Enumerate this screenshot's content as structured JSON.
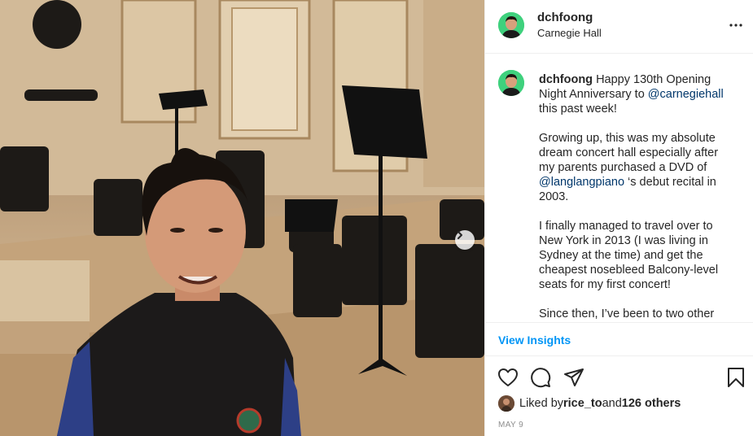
{
  "post": {
    "username": "dchfoong",
    "location": "Carnegie Hall",
    "caption": {
      "username": "dchfoong",
      "p1_a": "Happy 130th Opening Night Anniversary to ",
      "p1_mention": "@carnegiehall",
      "p1_b": " this past week!",
      "p2_a": "Growing up, this was my absolute dream concert hall especially after my parents purchased a DVD of ",
      "p2_mention": "@langlangpiano",
      "p2_b": " ‘s debut recital in 2003.",
      "p3": "I finally managed to travel over to New York in 2013 (I was living in Sydney at the time) and get the cheapest nosebleed Balcony-level seats for my first concert!",
      "p4": "Since then, I’ve been to two other"
    },
    "insights_label": "View Insights",
    "likes": {
      "prefix": "Liked by ",
      "user": "rice_to",
      "middle": " and ",
      "others": "126 others"
    },
    "date": "MAY 9"
  },
  "icons": {
    "more": "more-options-icon",
    "next": "chevron-right-icon",
    "like": "heart-icon",
    "comment": "comment-icon",
    "share": "paper-plane-icon",
    "save": "bookmark-icon"
  },
  "colors": {
    "link": "#00376b",
    "accent": "#0095f6",
    "muted": "#8e8e8e",
    "avatar_bg": "#3fd17d"
  }
}
